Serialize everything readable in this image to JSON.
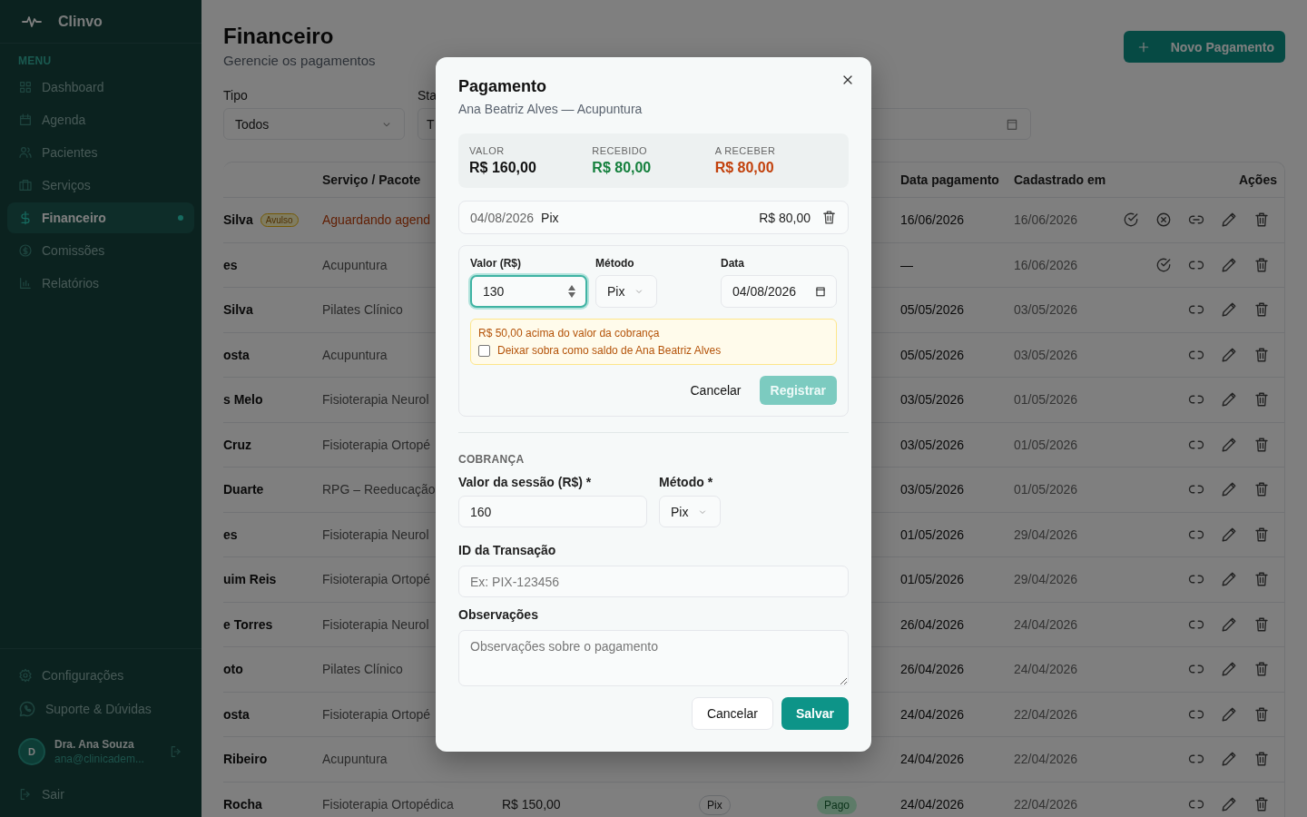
{
  "sidebar": {
    "brand": "Clinvo",
    "menu_label": "MENU",
    "items": [
      {
        "label": "Dashboard",
        "selected": false
      },
      {
        "label": "Agenda",
        "selected": false
      },
      {
        "label": "Pacientes",
        "selected": false
      },
      {
        "label": "Serviços",
        "selected": false
      },
      {
        "label": "Financeiro",
        "selected": true
      },
      {
        "label": "Comissões",
        "selected": false
      },
      {
        "label": "Relatórios",
        "selected": false
      }
    ],
    "footer_items": [
      {
        "label": "Configurações"
      },
      {
        "label": "Suporte & Dúvidas"
      }
    ],
    "user": {
      "initial": "D",
      "name": "Dra. Ana Souza",
      "email": "ana@clinicadem..."
    },
    "logout": "Sair"
  },
  "header": {
    "title": "Financeiro",
    "subtitle": "Gerencie os pagamentos",
    "new_button": "Novo Pagamento"
  },
  "filters": [
    {
      "kind": "select",
      "label": "Tipo",
      "value": "Todos"
    },
    {
      "kind": "select",
      "label": "Sta",
      "value": "T"
    },
    {
      "kind": "date"
    }
  ],
  "table": {
    "columns": [
      "Serviço / Pacote",
      "Data pagamento",
      "Cadastrado em",
      "Ações"
    ],
    "rows": [
      {
        "name": "Silva",
        "tag": "Avulso",
        "service": "Aguardando agend",
        "pending": true,
        "paid": "16/06/2026",
        "created": "16/06/2026",
        "actions": [
          {
            "kind": "confirm"
          },
          {
            "kind": "cancel"
          },
          {
            "kind": "link"
          },
          {
            "kind": "edit"
          },
          {
            "kind": "delete"
          }
        ]
      },
      {
        "name": "es",
        "service": "Acupuntura",
        "pending": false,
        "paid": "—",
        "created": "16/06/2026",
        "actions": [
          {
            "kind": "confirm"
          },
          {
            "kind": "unlink"
          },
          {
            "kind": "edit"
          },
          {
            "kind": "delete"
          }
        ]
      },
      {
        "name": "Silva",
        "service": "Pilates Clínico",
        "pending": false,
        "paid": "05/05/2026",
        "created": "03/05/2026",
        "actions": [
          {
            "kind": "unlink"
          },
          {
            "kind": "edit"
          },
          {
            "kind": "delete"
          }
        ]
      },
      {
        "name": "osta",
        "service": "Acupuntura",
        "pending": false,
        "paid": "05/05/2026",
        "created": "03/05/2026",
        "actions": [
          {
            "kind": "unlink"
          },
          {
            "kind": "edit"
          },
          {
            "kind": "delete"
          }
        ]
      },
      {
        "name": "s Melo",
        "service": "Fisioterapia Neurol",
        "pending": false,
        "paid": "03/05/2026",
        "created": "01/05/2026",
        "actions": [
          {
            "kind": "unlink"
          },
          {
            "kind": "edit"
          },
          {
            "kind": "delete"
          }
        ]
      },
      {
        "name": "Cruz",
        "service": "Fisioterapia Ortopé",
        "pending": false,
        "paid": "03/05/2026",
        "created": "01/05/2026",
        "actions": [
          {
            "kind": "unlink"
          },
          {
            "kind": "edit"
          },
          {
            "kind": "delete"
          }
        ]
      },
      {
        "name": "Duarte",
        "service": "RPG – Reeducação",
        "pending": false,
        "paid": "03/05/2026",
        "created": "01/05/2026",
        "actions": [
          {
            "kind": "unlink"
          },
          {
            "kind": "edit"
          },
          {
            "kind": "delete"
          }
        ]
      },
      {
        "name": "es",
        "service": "Fisioterapia Neurol",
        "pending": false,
        "paid": "01/05/2026",
        "created": "29/04/2026",
        "actions": [
          {
            "kind": "unlink"
          },
          {
            "kind": "edit"
          },
          {
            "kind": "delete"
          }
        ]
      },
      {
        "name": "uim Reis",
        "service": "Fisioterapia Ortopé",
        "pending": false,
        "paid": "01/05/2026",
        "created": "29/04/2026",
        "actions": [
          {
            "kind": "unlink"
          },
          {
            "kind": "edit"
          },
          {
            "kind": "delete"
          }
        ]
      },
      {
        "name": "e Torres",
        "service": "Fisioterapia Neurol",
        "pending": false,
        "paid": "26/04/2026",
        "created": "24/04/2026",
        "actions": [
          {
            "kind": "unlink"
          },
          {
            "kind": "edit"
          },
          {
            "kind": "delete"
          }
        ]
      },
      {
        "name": "oto",
        "service": "Pilates Clínico",
        "pending": false,
        "paid": "26/04/2026",
        "created": "24/04/2026",
        "actions": [
          {
            "kind": "unlink"
          },
          {
            "kind": "edit"
          },
          {
            "kind": "delete"
          }
        ]
      },
      {
        "name": "osta",
        "service": "Fisioterapia Ortopé",
        "pending": false,
        "paid": "24/04/2026",
        "created": "22/04/2026",
        "actions": [
          {
            "kind": "unlink"
          },
          {
            "kind": "edit"
          },
          {
            "kind": "delete"
          }
        ]
      },
      {
        "name": "Ribeiro",
        "service": "Acupuntura",
        "pending": false,
        "paid": "24/04/2026",
        "created": "22/04/2026",
        "actions": [
          {
            "kind": "unlink"
          },
          {
            "kind": "edit"
          },
          {
            "kind": "delete"
          }
        ]
      },
      {
        "name": "Rocha",
        "service": "Fisioterapia Ortopédica",
        "pending": false,
        "value": "R$ 150,00",
        "method": "Pix",
        "status": "Pago",
        "paid": "24/04/2026",
        "created": "22/04/2026",
        "actions": [
          {
            "kind": "unlink"
          },
          {
            "kind": "edit"
          },
          {
            "kind": "delete"
          }
        ]
      }
    ]
  },
  "modal": {
    "title": "Pagamento",
    "subtitle": "Ana Beatriz Alves — Acupuntura",
    "summary": [
      {
        "label": "VALOR",
        "value": "R$ 160,00",
        "color": "#111111"
      },
      {
        "label": "RECEBIDO",
        "value": "R$ 80,00",
        "color": "#15803d"
      },
      {
        "label": "A RECEBER",
        "value": "R$ 80,00",
        "color": "#c2410c"
      }
    ],
    "payments": [
      {
        "date": "04/08/2026",
        "method": "Pix",
        "amount": "R$ 80,00"
      }
    ],
    "new_payment": {
      "amount_label": "Valor (R$)",
      "amount": "130",
      "method_label": "Método",
      "method": "Pix",
      "date_label": "Data",
      "date": "04/08/2026",
      "warning": "R$ 50,00 acima do valor da cobrança",
      "keep_balance_label": "Deixar sobra como saldo de Ana Beatriz Alves",
      "keep_balance": false,
      "cancel": "Cancelar",
      "submit": "Registrar",
      "submit_disabled": true
    },
    "section_label": "COBRANÇA",
    "session_label": "Valor da sessão (R$) *",
    "session_value": "160",
    "method_label": "Método *",
    "method": "Pix",
    "transaction_label": "ID da Transação",
    "transaction_placeholder": "Ex: PIX-123456",
    "notes_label": "Observações",
    "notes_placeholder": "Observações sobre o pagamento",
    "cancel": "Cancelar",
    "save": "Salvar"
  }
}
